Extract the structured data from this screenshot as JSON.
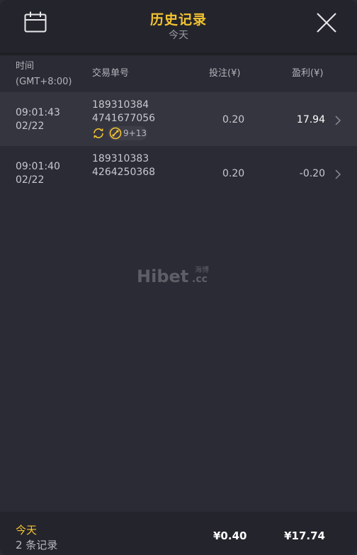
{
  "header": {
    "title": "历史记录",
    "subtitle": "今天",
    "calendar_icon": "calendar-icon",
    "close_icon": "close-icon"
  },
  "columns": {
    "time_line1": "时间",
    "time_line2": "(GMT+8:00)",
    "order": "交易单号",
    "stake": "投注(¥)",
    "profit": "盈利(¥)"
  },
  "rows": [
    {
      "time": "09:01:43",
      "date": "02/22",
      "order_line1": "189310384",
      "order_line2": "4741677056",
      "tags": {
        "refresh_icon": "refresh-icon",
        "ball_icon": "soccer-icon",
        "score": "9+13"
      },
      "stake": "0.20",
      "profit": "17.94"
    },
    {
      "time": "09:01:40",
      "date": "02/22",
      "order_line1": "189310383",
      "order_line2": "4264250368",
      "stake": "0.20",
      "profit": "-0.20"
    }
  ],
  "watermark": {
    "text": "Hibet",
    "suffix": ".cc",
    "cn": "海博"
  },
  "footer": {
    "period": "今天",
    "count": "2 条记录",
    "total_stake": "¥0.40",
    "total_profit": "¥17.74"
  },
  "colors": {
    "accent": "#f4c430",
    "background": "#2b2b35",
    "header": "#24242c"
  }
}
